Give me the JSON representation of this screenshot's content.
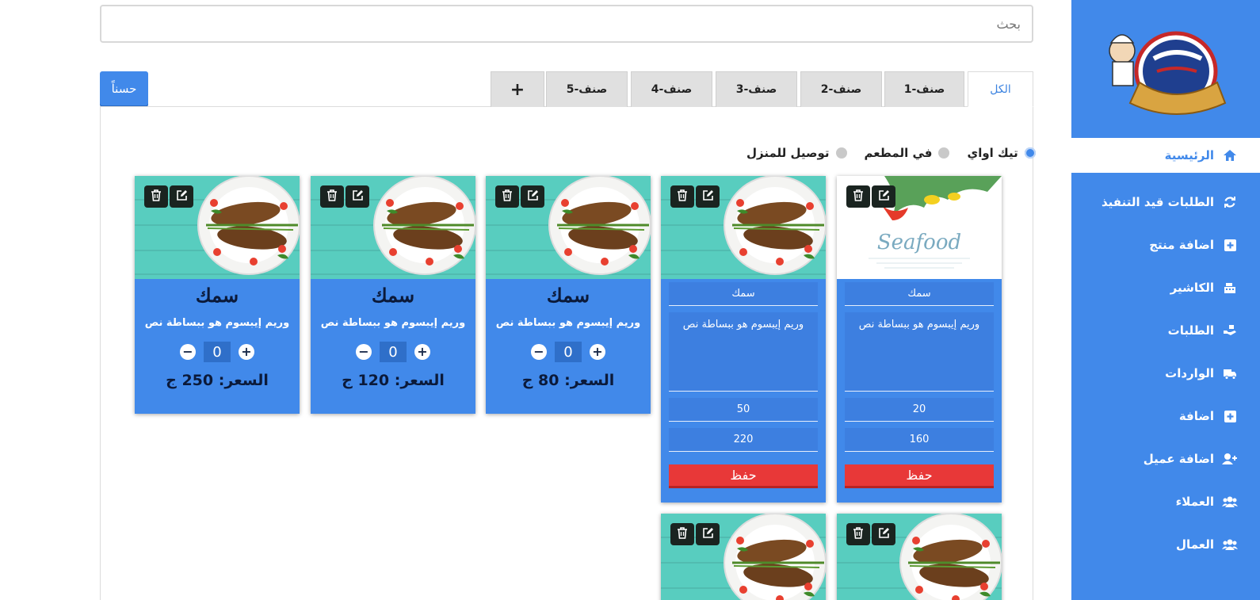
{
  "search": {
    "placeholder": "بحث"
  },
  "ok_button": "حسناً",
  "tabs": [
    {
      "label": "الكل",
      "active": true
    },
    {
      "label": "صنف-1"
    },
    {
      "label": "صنف-2"
    },
    {
      "label": "صنف-3"
    },
    {
      "label": "صنف-4"
    },
    {
      "label": "صنف-5"
    },
    {
      "label": "+"
    }
  ],
  "order_types": [
    {
      "label": "تيك اواي",
      "checked": true
    },
    {
      "label": "في المطعم",
      "checked": false
    },
    {
      "label": "توصيل للمنزل",
      "checked": false
    }
  ],
  "sidebar": {
    "items": [
      {
        "label": "الرئيسية",
        "icon": "home-icon"
      },
      {
        "label": "الطلبات قيد التنفيذ",
        "icon": "sync-icon"
      },
      {
        "label": "اضافة منتج",
        "icon": "plus-square-icon"
      },
      {
        "label": "الكاشير",
        "icon": "cash-register-icon"
      },
      {
        "label": "الطلبات",
        "icon": "hand-order-icon"
      },
      {
        "label": "الواردات",
        "icon": "truck-icon"
      },
      {
        "label": "اضافة",
        "icon": "plus-square-icon"
      },
      {
        "label": "اضافة عميل",
        "icon": "user-plus-icon"
      },
      {
        "label": "العملاء",
        "icon": "users-icon"
      },
      {
        "label": "العمال",
        "icon": "users-icon"
      }
    ]
  },
  "edit_cards": [
    {
      "name": "سمك",
      "description": "وريم إيبسوم هو ببساطة نص",
      "field1": "20",
      "field2": "160",
      "save": "حفظ",
      "image": "seafood"
    },
    {
      "name": "سمك",
      "description": "وريم إيبسوم هو ببساطة نص",
      "field1": "50",
      "field2": "220",
      "save": "حفظ",
      "image": "fish-plate"
    }
  ],
  "product_cards": [
    {
      "name": "سمك",
      "description": "وريم إيبسوم هو ببساطة نص",
      "qty": "0",
      "price": "السعر: 80 ج"
    },
    {
      "name": "سمك",
      "description": "وريم إيبسوم هو ببساطة نص",
      "qty": "0",
      "price": "السعر: 120 ج"
    },
    {
      "name": "سمك",
      "description": "وريم إيبسوم هو ببساطة نص",
      "qty": "0",
      "price": "السعر: 250 ج"
    }
  ],
  "image_text": {
    "seafood": "Seafood"
  },
  "colors": {
    "primary": "#4189ea",
    "danger": "#e83838"
  }
}
